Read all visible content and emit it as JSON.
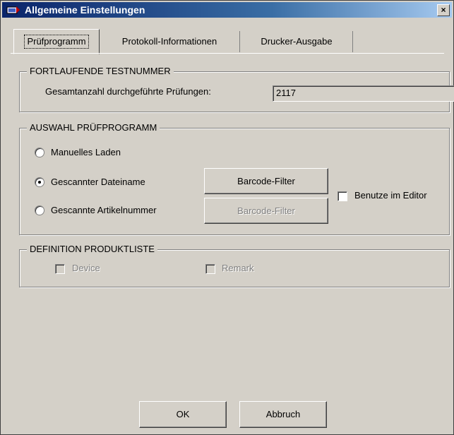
{
  "window": {
    "title": "Allgemeine Einstellungen",
    "close_label": "×"
  },
  "tabs": [
    {
      "label": "Prüfprogramm",
      "active": true
    },
    {
      "label": "Protokoll-Informationen",
      "active": false
    },
    {
      "label": "Drucker-Ausgabe",
      "active": false
    }
  ],
  "testnummer": {
    "group_title": "FORTLAUFENDE TESTNUMMER",
    "label": "Gesamtanzahl durchgeführte Prüfungen:",
    "value": "2117"
  },
  "pruefprogramm": {
    "group_title": "AUSWAHL PRÜFPROGRAMM",
    "options": [
      {
        "label": "Manuelles Laden",
        "checked": false
      },
      {
        "label": "Gescannter Dateiname",
        "checked": true
      },
      {
        "label": "Gescannte Artikelnummer",
        "checked": false
      }
    ],
    "barcode_filter_label": "Barcode-Filter",
    "barcode_filter_disabled_label": "Barcode-Filter",
    "editor_checkbox_label": "Benutze im Editor"
  },
  "produktliste": {
    "group_title": "DEFINITION PRODUKTLISTE",
    "device_label": "Device",
    "remark_label": "Remark"
  },
  "buttons": {
    "ok": "OK",
    "cancel": "Abbruch"
  }
}
